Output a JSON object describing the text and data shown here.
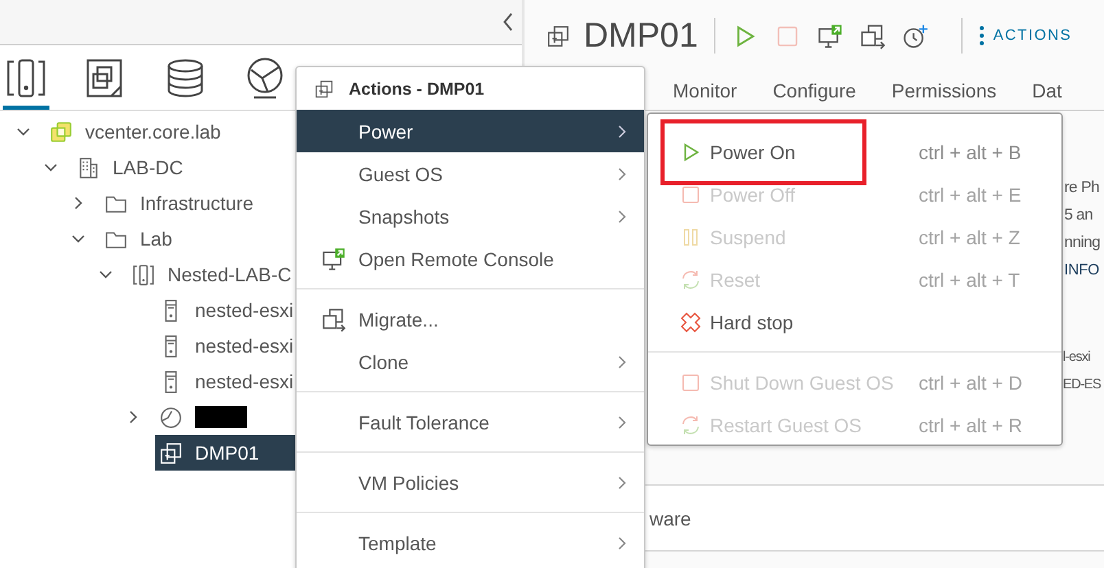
{
  "sidebar": {
    "nav_tabs": [
      {
        "kind": "hosts-clusters",
        "selected": true
      },
      {
        "kind": "vms-templates",
        "selected": false
      },
      {
        "kind": "storage",
        "selected": false
      },
      {
        "kind": "networking",
        "selected": false
      }
    ],
    "tree": [
      {
        "label": "vcenter.core.lab",
        "kind": "vcenter",
        "expanded": true,
        "selected": false,
        "children": [
          {
            "label": "LAB-DC",
            "kind": "datacenter",
            "expanded": true,
            "selected": false,
            "children": [
              {
                "label": "Infrastructure",
                "kind": "folder",
                "expanded": false,
                "selected": false
              },
              {
                "label": "Lab",
                "kind": "folder",
                "expanded": true,
                "selected": false,
                "children": [
                  {
                    "label": "Nested-LAB-C",
                    "kind": "cluster",
                    "expanded": true,
                    "selected": false,
                    "children": [
                      {
                        "label": "nested-esxi",
                        "kind": "host",
                        "selected": false
                      },
                      {
                        "label": "nested-esxi",
                        "kind": "host",
                        "selected": false
                      },
                      {
                        "label": "nested-esxi",
                        "kind": "host",
                        "selected": false
                      },
                      {
                        "kind": "resource-pool",
                        "redacted": true,
                        "expanded": false,
                        "selected": false
                      },
                      {
                        "label": "DMP01",
                        "kind": "vm",
                        "selected": true
                      }
                    ]
                  }
                ]
              }
            ]
          }
        ]
      }
    ]
  },
  "header": {
    "title": "DMP01",
    "toolbar": [
      {
        "kind": "power-on",
        "disabled": false
      },
      {
        "kind": "power-off",
        "disabled": true
      },
      {
        "kind": "console",
        "disabled": false
      },
      {
        "kind": "migrate",
        "disabled": false
      },
      {
        "kind": "snapshot",
        "disabled": false
      }
    ],
    "actions_button": "ACTIONS"
  },
  "tabs": [
    {
      "label": "Monitor",
      "selected": false
    },
    {
      "label": "Configure",
      "selected": false
    },
    {
      "label": "Permissions",
      "selected": false
    },
    {
      "label": "Dat",
      "selected": false
    }
  ],
  "details_fragments": [
    [
      {
        "text": "re Ph",
        "kind": "text"
      },
      {
        "text": "5 an",
        "kind": "text"
      },
      {
        "text": "nning",
        "kind": "text"
      },
      {
        "text": "INFO",
        "kind": "link"
      }
    ],
    [
      {
        "text": "l-esxi",
        "kind": "text"
      },
      {
        "text": "ED-ES",
        "kind": "text"
      }
    ]
  ],
  "table_row_fragment": "ware",
  "actions_menu": {
    "title": "Actions - DMP01",
    "items": [
      {
        "kind": "submenu",
        "label": "Power",
        "selected": true
      },
      {
        "kind": "submenu",
        "label": "Guest OS",
        "selected": false
      },
      {
        "kind": "submenu",
        "label": "Snapshots",
        "selected": false
      },
      {
        "kind": "console",
        "label": "Open Remote Console",
        "selected": false
      },
      {
        "kind": "divider"
      },
      {
        "kind": "migrate",
        "label": "Migrate...",
        "selected": false
      },
      {
        "kind": "submenu",
        "label": "Clone",
        "selected": false
      },
      {
        "kind": "divider"
      },
      {
        "kind": "submenu",
        "label": "Fault Tolerance",
        "selected": false
      },
      {
        "kind": "divider"
      },
      {
        "kind": "submenu",
        "label": "VM Policies",
        "selected": false
      },
      {
        "kind": "divider"
      },
      {
        "kind": "submenu",
        "label": "Template",
        "selected": false
      }
    ]
  },
  "power_menu": {
    "items": [
      {
        "kind": "power-on",
        "label": "Power On",
        "shortcut": "ctrl + alt + B",
        "disabled": false,
        "annotated": true
      },
      {
        "kind": "power-off",
        "label": "Power Off",
        "shortcut": "ctrl + alt + E",
        "disabled": true,
        "annotated": false
      },
      {
        "kind": "suspend",
        "label": "Suspend",
        "shortcut": "ctrl + alt + Z",
        "disabled": true,
        "annotated": false
      },
      {
        "kind": "reset",
        "label": "Reset",
        "shortcut": "ctrl + alt + T",
        "disabled": true,
        "annotated": false
      },
      {
        "kind": "hard-stop",
        "label": "Hard stop",
        "disabled": false,
        "annotated": false
      },
      {
        "kind": "divider"
      },
      {
        "kind": "shutdown",
        "label": "Shut Down Guest OS",
        "shortcut": "ctrl + alt + D",
        "disabled": true,
        "annotated": false
      },
      {
        "kind": "restart",
        "label": "Restart Guest OS",
        "shortcut": "ctrl + alt + R",
        "disabled": true,
        "annotated": false
      }
    ]
  }
}
